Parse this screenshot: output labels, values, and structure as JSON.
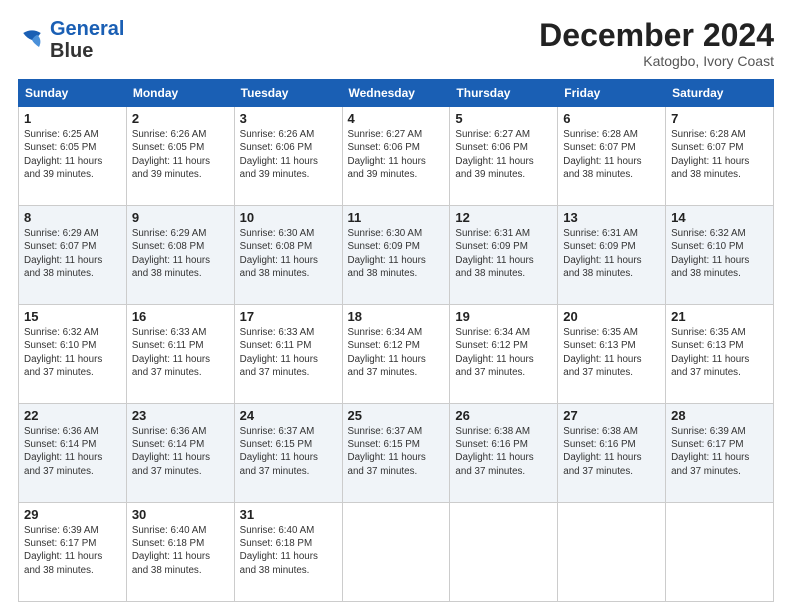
{
  "header": {
    "logo_line1": "General",
    "logo_line2": "Blue",
    "month": "December 2024",
    "location": "Katogbo, Ivory Coast"
  },
  "days_of_week": [
    "Sunday",
    "Monday",
    "Tuesday",
    "Wednesday",
    "Thursday",
    "Friday",
    "Saturday"
  ],
  "weeks": [
    [
      {
        "day": "1",
        "info": "Sunrise: 6:25 AM\nSunset: 6:05 PM\nDaylight: 11 hours\nand 39 minutes."
      },
      {
        "day": "2",
        "info": "Sunrise: 6:26 AM\nSunset: 6:05 PM\nDaylight: 11 hours\nand 39 minutes."
      },
      {
        "day": "3",
        "info": "Sunrise: 6:26 AM\nSunset: 6:06 PM\nDaylight: 11 hours\nand 39 minutes."
      },
      {
        "day": "4",
        "info": "Sunrise: 6:27 AM\nSunset: 6:06 PM\nDaylight: 11 hours\nand 39 minutes."
      },
      {
        "day": "5",
        "info": "Sunrise: 6:27 AM\nSunset: 6:06 PM\nDaylight: 11 hours\nand 39 minutes."
      },
      {
        "day": "6",
        "info": "Sunrise: 6:28 AM\nSunset: 6:07 PM\nDaylight: 11 hours\nand 38 minutes."
      },
      {
        "day": "7",
        "info": "Sunrise: 6:28 AM\nSunset: 6:07 PM\nDaylight: 11 hours\nand 38 minutes."
      }
    ],
    [
      {
        "day": "8",
        "info": "Sunrise: 6:29 AM\nSunset: 6:07 PM\nDaylight: 11 hours\nand 38 minutes."
      },
      {
        "day": "9",
        "info": "Sunrise: 6:29 AM\nSunset: 6:08 PM\nDaylight: 11 hours\nand 38 minutes."
      },
      {
        "day": "10",
        "info": "Sunrise: 6:30 AM\nSunset: 6:08 PM\nDaylight: 11 hours\nand 38 minutes."
      },
      {
        "day": "11",
        "info": "Sunrise: 6:30 AM\nSunset: 6:09 PM\nDaylight: 11 hours\nand 38 minutes."
      },
      {
        "day": "12",
        "info": "Sunrise: 6:31 AM\nSunset: 6:09 PM\nDaylight: 11 hours\nand 38 minutes."
      },
      {
        "day": "13",
        "info": "Sunrise: 6:31 AM\nSunset: 6:09 PM\nDaylight: 11 hours\nand 38 minutes."
      },
      {
        "day": "14",
        "info": "Sunrise: 6:32 AM\nSunset: 6:10 PM\nDaylight: 11 hours\nand 38 minutes."
      }
    ],
    [
      {
        "day": "15",
        "info": "Sunrise: 6:32 AM\nSunset: 6:10 PM\nDaylight: 11 hours\nand 37 minutes."
      },
      {
        "day": "16",
        "info": "Sunrise: 6:33 AM\nSunset: 6:11 PM\nDaylight: 11 hours\nand 37 minutes."
      },
      {
        "day": "17",
        "info": "Sunrise: 6:33 AM\nSunset: 6:11 PM\nDaylight: 11 hours\nand 37 minutes."
      },
      {
        "day": "18",
        "info": "Sunrise: 6:34 AM\nSunset: 6:12 PM\nDaylight: 11 hours\nand 37 minutes."
      },
      {
        "day": "19",
        "info": "Sunrise: 6:34 AM\nSunset: 6:12 PM\nDaylight: 11 hours\nand 37 minutes."
      },
      {
        "day": "20",
        "info": "Sunrise: 6:35 AM\nSunset: 6:13 PM\nDaylight: 11 hours\nand 37 minutes."
      },
      {
        "day": "21",
        "info": "Sunrise: 6:35 AM\nSunset: 6:13 PM\nDaylight: 11 hours\nand 37 minutes."
      }
    ],
    [
      {
        "day": "22",
        "info": "Sunrise: 6:36 AM\nSunset: 6:14 PM\nDaylight: 11 hours\nand 37 minutes."
      },
      {
        "day": "23",
        "info": "Sunrise: 6:36 AM\nSunset: 6:14 PM\nDaylight: 11 hours\nand 37 minutes."
      },
      {
        "day": "24",
        "info": "Sunrise: 6:37 AM\nSunset: 6:15 PM\nDaylight: 11 hours\nand 37 minutes."
      },
      {
        "day": "25",
        "info": "Sunrise: 6:37 AM\nSunset: 6:15 PM\nDaylight: 11 hours\nand 37 minutes."
      },
      {
        "day": "26",
        "info": "Sunrise: 6:38 AM\nSunset: 6:16 PM\nDaylight: 11 hours\nand 37 minutes."
      },
      {
        "day": "27",
        "info": "Sunrise: 6:38 AM\nSunset: 6:16 PM\nDaylight: 11 hours\nand 37 minutes."
      },
      {
        "day": "28",
        "info": "Sunrise: 6:39 AM\nSunset: 6:17 PM\nDaylight: 11 hours\nand 37 minutes."
      }
    ],
    [
      {
        "day": "29",
        "info": "Sunrise: 6:39 AM\nSunset: 6:17 PM\nDaylight: 11 hours\nand 38 minutes."
      },
      {
        "day": "30",
        "info": "Sunrise: 6:40 AM\nSunset: 6:18 PM\nDaylight: 11 hours\nand 38 minutes."
      },
      {
        "day": "31",
        "info": "Sunrise: 6:40 AM\nSunset: 6:18 PM\nDaylight: 11 hours\nand 38 minutes."
      },
      null,
      null,
      null,
      null
    ]
  ]
}
